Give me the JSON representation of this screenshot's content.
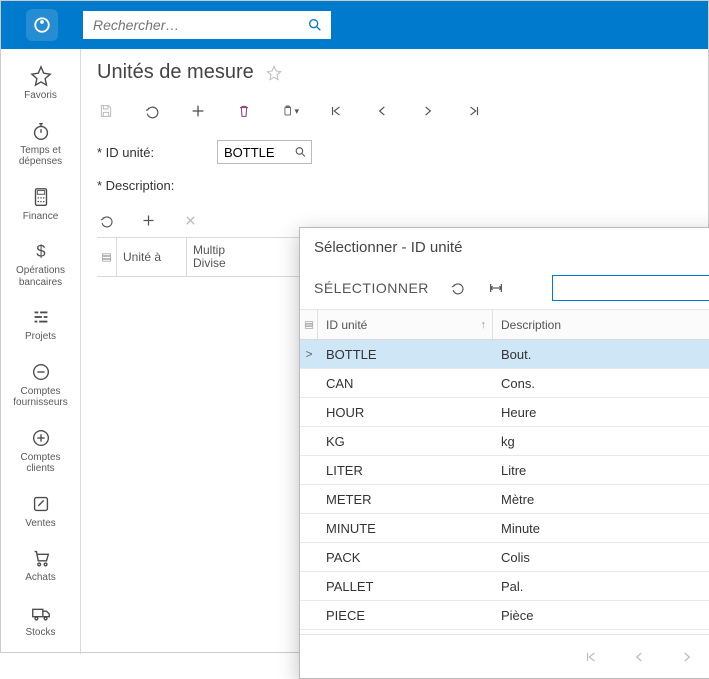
{
  "search": {
    "placeholder": "Rechercher…"
  },
  "sidebar": {
    "items": [
      {
        "label": "Favoris"
      },
      {
        "label": "Temps et dépenses"
      },
      {
        "label": "Finance"
      },
      {
        "label": "Opérations bancaires"
      },
      {
        "label": "Projets"
      },
      {
        "label": "Comptes fournisseurs"
      },
      {
        "label": "Comptes clients"
      },
      {
        "label": "Ventes"
      },
      {
        "label": "Achats"
      },
      {
        "label": "Stocks"
      }
    ]
  },
  "page": {
    "title": "Unités de mesure"
  },
  "form": {
    "id_label": "ID unité:",
    "id_value": "BOTTLE",
    "desc_label": "Description:"
  },
  "subgrid": {
    "col_unit": "Unité à",
    "col_mult": "Multip Divise"
  },
  "popup": {
    "title": "Sélectionner - ID unité",
    "select": "SÉLECTIONNER",
    "search_value": "",
    "col_id": "ID unité",
    "col_desc": "Description",
    "rows": [
      {
        "id": "BOTTLE",
        "desc": "Bout."
      },
      {
        "id": "CAN",
        "desc": "Cons."
      },
      {
        "id": "HOUR",
        "desc": "Heure"
      },
      {
        "id": "KG",
        "desc": "kg"
      },
      {
        "id": "LITER",
        "desc": "Litre"
      },
      {
        "id": "METER",
        "desc": "Mètre"
      },
      {
        "id": "MINUTE",
        "desc": "Minute"
      },
      {
        "id": "PACK",
        "desc": "Colis"
      },
      {
        "id": "PALLET",
        "desc": "Pal."
      },
      {
        "id": "PIECE",
        "desc": "Pièce"
      }
    ]
  }
}
